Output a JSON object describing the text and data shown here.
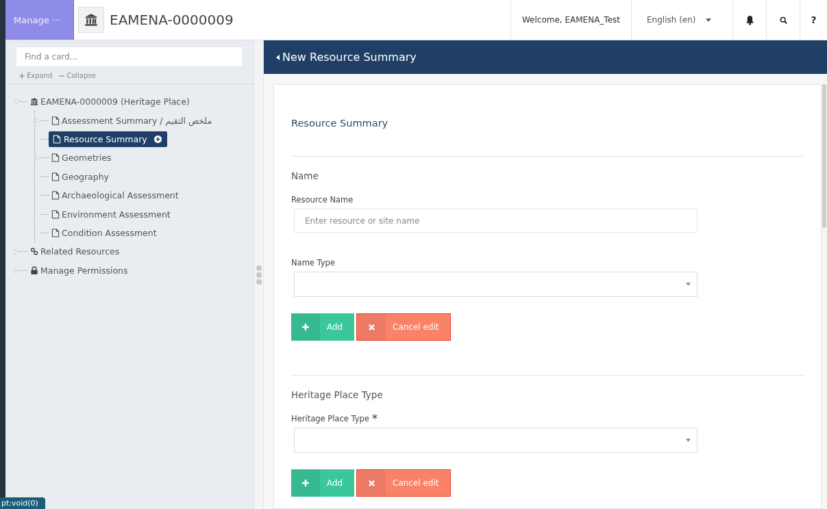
{
  "topbar": {
    "manage_label": "Manage ···",
    "resource_id": "EAMENA-0000009",
    "welcome": "Welcome, EAMENA_Test",
    "language": "English (en)",
    "help": "?"
  },
  "sidebar": {
    "search_placeholder": "Find a card...",
    "expand": "Expand",
    "collapse": "Collapse",
    "tree": [
      {
        "label": "EAMENA-0000009 (Heritage Place)",
        "kind": "building",
        "expanded": true,
        "selected": false,
        "children": [
          {
            "label": "Assessment Summary / ملخص التقيم",
            "kind": "file",
            "expanded": false,
            "selected": false
          },
          {
            "label": "Resource Summary",
            "kind": "file",
            "selected": true
          },
          {
            "label": "Geometries",
            "kind": "file",
            "expanded": false,
            "selected": false
          },
          {
            "label": "Geography",
            "kind": "file",
            "selected": false
          },
          {
            "label": "Archaeological Assessment",
            "kind": "file",
            "selected": false
          },
          {
            "label": "Environment Assessment",
            "kind": "file",
            "selected": false
          },
          {
            "label": "Condition Assessment",
            "kind": "file",
            "selected": false
          }
        ]
      },
      {
        "label": "Related Resources",
        "kind": "link",
        "expanded": false,
        "selected": false
      },
      {
        "label": "Manage Permissions",
        "kind": "lock",
        "expanded": false,
        "selected": false
      }
    ]
  },
  "main": {
    "header": "New Resource Summary",
    "card_title": "Resource Summary",
    "sections": [
      {
        "title": "Name",
        "fields": [
          {
            "kind": "input",
            "label": "Resource Name",
            "required": false,
            "placeholder": "Enter resource or site name"
          },
          {
            "kind": "select",
            "label": "Name Type",
            "required": false
          }
        ],
        "add": "Add",
        "cancel": "Cancel edit"
      },
      {
        "title": "Heritage Place Type",
        "fields": [
          {
            "kind": "select",
            "label": "Heritage Place Type",
            "required": true
          }
        ],
        "add": "Add",
        "cancel": "Cancel edit"
      }
    ]
  },
  "status_bar": "pt:void(0)"
}
